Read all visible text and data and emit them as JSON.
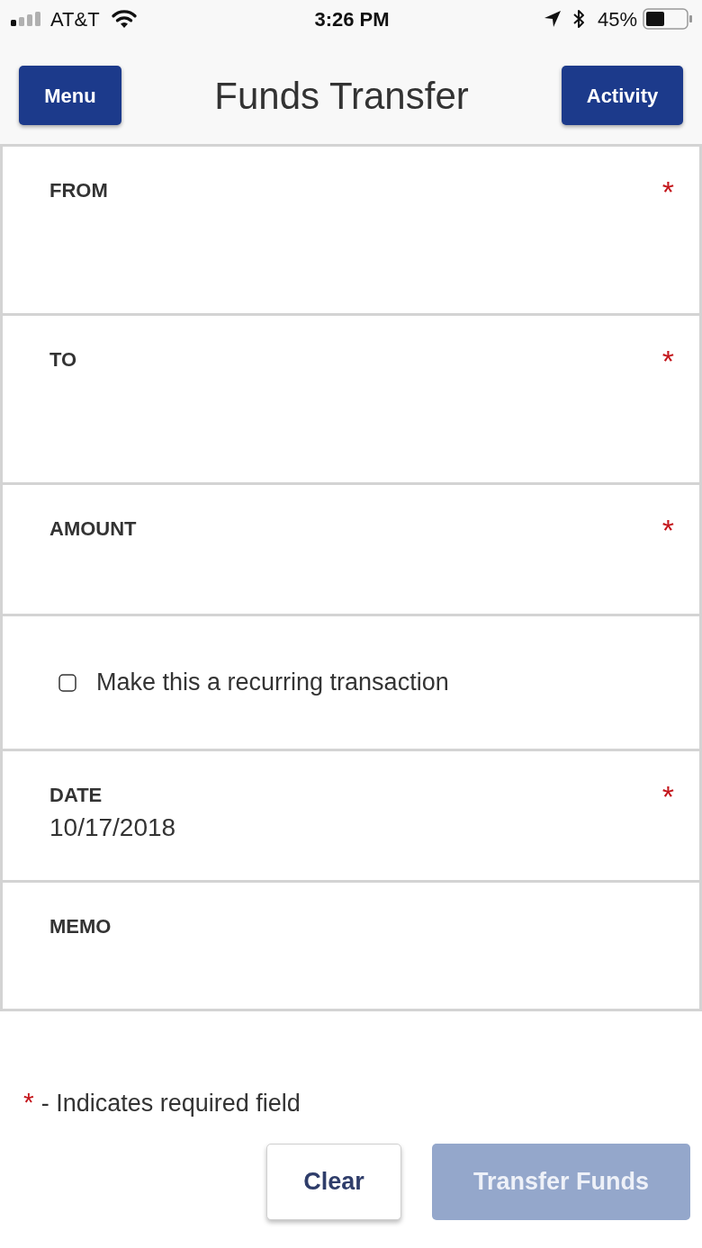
{
  "status_bar": {
    "carrier": "AT&T",
    "time": "3:26 PM",
    "battery": "45%"
  },
  "header": {
    "title": "Funds Transfer",
    "left_button": {
      "label": "Menu"
    },
    "right_button": {
      "label": "Activity"
    }
  },
  "fields": [
    {
      "kind": "select",
      "label": "FROM",
      "required_mark": "*"
    },
    {
      "kind": "select",
      "label": "TO",
      "required_mark": "*"
    },
    {
      "kind": "input",
      "label": "AMOUNT",
      "required_mark": "*"
    },
    {
      "kind": "checkbox",
      "label": "Make this a recurring transaction",
      "checked": false
    },
    {
      "kind": "input",
      "label": "DATE",
      "required_mark": "*",
      "value": "10/17/2018"
    },
    {
      "kind": "input",
      "label": "MEMO"
    }
  ],
  "required_note": {
    "mark": "*",
    "text": "- Indicates required field"
  },
  "buttons": [
    {
      "label": "Clear",
      "kind": "outline",
      "disabled": false
    },
    {
      "label": "Transfer Funds",
      "kind": "primary",
      "disabled": true
    }
  ]
}
